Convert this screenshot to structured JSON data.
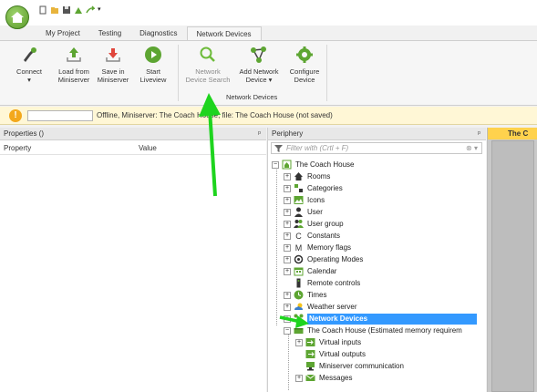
{
  "tabs": [
    "My Project",
    "Testing",
    "Diagnostics",
    "Network Devices"
  ],
  "active_tab": "Network Devices",
  "ribbon": {
    "buttons": [
      {
        "label": "Connect",
        "line2": "▾"
      },
      {
        "label": "Load from",
        "line2": "Miniserver"
      },
      {
        "label": "Save in",
        "line2": "Miniserver"
      },
      {
        "label": "Start",
        "line2": "Liveview"
      },
      {
        "label": "Network",
        "line2": "Device Search"
      },
      {
        "label": "Add Network",
        "line2": "Device ▾"
      },
      {
        "label": "Configure",
        "line2": "Device"
      }
    ],
    "group_label": "Network Devices"
  },
  "infobar": {
    "icon": "!",
    "text": "Offline, Miniserver: The Coach House, file: The Coach House (not saved)"
  },
  "properties": {
    "title": "Properties ()",
    "pin": "ᵖ",
    "col_property": "Property",
    "col_value": "Value"
  },
  "periphery": {
    "title": "Periphery",
    "pin": "ᵖ",
    "filter_placeholder": "Filter with (Crtl + F)",
    "clear": "⊗ ▾",
    "tree": [
      {
        "label": "The Coach House",
        "icon": "house-icon",
        "expander": "−"
      },
      {
        "label": "Rooms",
        "icon": "rooms-icon",
        "expander": "+"
      },
      {
        "label": "Categories",
        "icon": "categories-icon",
        "expander": "+"
      },
      {
        "label": "Icons",
        "icon": "icons-icon",
        "expander": "+"
      },
      {
        "label": "User",
        "icon": "user-icon",
        "expander": "+"
      },
      {
        "label": "User group",
        "icon": "user-group-icon",
        "expander": "+"
      },
      {
        "label": "Constants",
        "icon": "constants-icon",
        "expander": "+"
      },
      {
        "label": "Memory flags",
        "icon": "memory-flags-icon",
        "expander": "+"
      },
      {
        "label": "Operating Modes",
        "icon": "operating-modes-icon",
        "expander": "+"
      },
      {
        "label": "Calendar",
        "icon": "calendar-icon",
        "expander": "+"
      },
      {
        "label": "Remote controls",
        "icon": "remote-icon",
        "expander": ""
      },
      {
        "label": "Times",
        "icon": "times-icon",
        "expander": "+"
      },
      {
        "label": "Weather server",
        "icon": "weather-icon",
        "expander": "+"
      },
      {
        "label": "Network Devices",
        "icon": "network-devices-icon",
        "expander": "+"
      },
      {
        "label": "The Coach House (Estimated memory requirem",
        "icon": "miniserver-icon",
        "expander": "−"
      },
      {
        "label": "Virtual inputs",
        "icon": "virtual-inputs-icon",
        "expander": "+"
      },
      {
        "label": "Virtual outputs",
        "icon": "virtual-outputs-icon",
        "expander": ""
      },
      {
        "label": "Miniserver communication",
        "icon": "communication-icon",
        "expander": ""
      },
      {
        "label": "Messages",
        "icon": "messages-icon",
        "expander": "+"
      }
    ],
    "selected": "Network Devices"
  },
  "right_tab": {
    "label": "The C"
  },
  "colors": {
    "accent_green": "#1ed41e",
    "selection_blue": "#3399ff",
    "tab_yellow": "#ffd24d"
  }
}
